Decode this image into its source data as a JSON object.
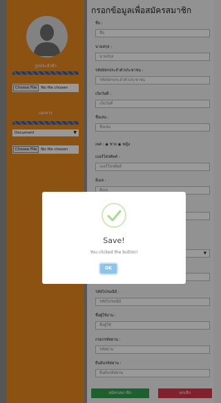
{
  "sidebar": {
    "profile_label": "รูปประจำตัว",
    "file_button": "Choose File",
    "file_status": "No file chosen",
    "document_label": "เอกสาร",
    "document_select": "Document",
    "doc_file_button": "Choose File",
    "doc_file_status": "No file chosen"
  },
  "form": {
    "title": "กรอกข้อมูลเพื่อสมัครสมาชิก",
    "fields": [
      {
        "label": "ชื่อ :",
        "placeholder": "ชื่อ"
      },
      {
        "label": "นามสกุล :",
        "placeholder": "นามสกุล"
      },
      {
        "label": "รหัสบัตรประจำตัวประชาชน :",
        "placeholder": "รหัสบัตรประจำตัวประชาชน"
      },
      {
        "label": "เกิดวันที่ :",
        "placeholder": "เกิดวันที่"
      },
      {
        "label": "ชื่อเล่น :",
        "placeholder": "ชื่อเล่น"
      },
      {
        "label": "เบอร์โทรศัพท์ :",
        "placeholder": "เบอร์โทรศัพท์"
      },
      {
        "label": "อีเมล :",
        "placeholder": "อีเมล"
      },
      {
        "label": "รหัสไปรษณีย์ :",
        "placeholder": "รหัสไปรษณีย์"
      },
      {
        "label": "ชื่อผู้ใช้งาน :",
        "placeholder": "ชื่อผู้ใช้"
      },
      {
        "label": "กรอกรหัสผ่าน :",
        "placeholder": "รหัสผ่าน"
      },
      {
        "label": "ยืนยันรหัสผ่าน :",
        "placeholder": "ยืนยันรหัสผ่าน"
      }
    ],
    "gender_label": "เพศ :",
    "gender_male": "ชาย",
    "gender_female": "หญิง",
    "submit_label": "สมัครสมาชิก",
    "cancel_label": "ยกเลิก"
  },
  "modal": {
    "title": "Save!",
    "message": "You clicked the button!",
    "ok_label": "OK"
  },
  "colors": {
    "sidebar": "#e8891d",
    "submit": "#2ea14b",
    "cancel": "#d9364a",
    "ok_button": "#8cc4ee",
    "success_check": "#a5dc86"
  }
}
